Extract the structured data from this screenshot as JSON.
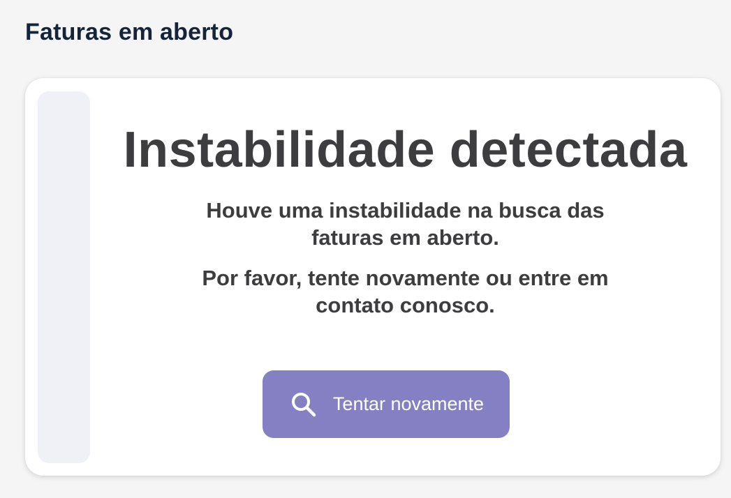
{
  "page": {
    "title": "Faturas em aberto"
  },
  "error_card": {
    "heading": "Instabilidade detectada",
    "message_line1": "Houve uma instabilidade na busca das faturas em aberto.",
    "message_line2": "Por favor, tente novamente ou entre em contato conosco.",
    "retry_button": {
      "label": "Tentar novamente",
      "icon": "search-icon",
      "color": "#8580c4"
    }
  },
  "colors": {
    "title": "#16243a",
    "text": "#3d3d3f",
    "background": "#f5f5f6",
    "card": "#ffffff",
    "strip": "#f0f1f7"
  }
}
